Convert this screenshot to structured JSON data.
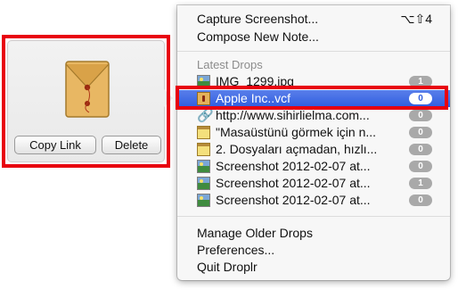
{
  "preview": {
    "copy_link_label": "Copy Link",
    "delete_label": "Delete",
    "icon": "vcard-envelope-icon"
  },
  "menu": {
    "capture_label": "Capture Screenshot...",
    "capture_shortcut": "⌥⇧4",
    "compose_label": "Compose New Note...",
    "section_title": "Latest Drops",
    "drops": [
      {
        "label": "IMG_1299.jpg",
        "badge": "1",
        "icon": "image-icon"
      },
      {
        "label": "Apple Inc..vcf",
        "badge": "0",
        "icon": "vcard-icon",
        "selected": true
      },
      {
        "label": "http://www.sihirlielma.com...",
        "badge": "0",
        "icon": "link-icon"
      },
      {
        "label": "\"Masaüstünü görmek için n...",
        "badge": "0",
        "icon": "note-icon"
      },
      {
        "label": "2. Dosyaları açmadan, hızlı...",
        "badge": "0",
        "icon": "note-icon"
      },
      {
        "label": "Screenshot 2012-02-07 at...",
        "badge": "0",
        "icon": "image-icon"
      },
      {
        "label": "Screenshot 2012-02-07 at...",
        "badge": "1",
        "icon": "image-icon"
      },
      {
        "label": "Screenshot 2012-02-07 at...",
        "badge": "0",
        "icon": "image-icon"
      }
    ],
    "manage_label": "Manage Older Drops",
    "preferences_label": "Preferences...",
    "quit_label": "Quit Droplr"
  },
  "colors": {
    "highlight": "#e8000f",
    "selection": "#3a66e2"
  }
}
